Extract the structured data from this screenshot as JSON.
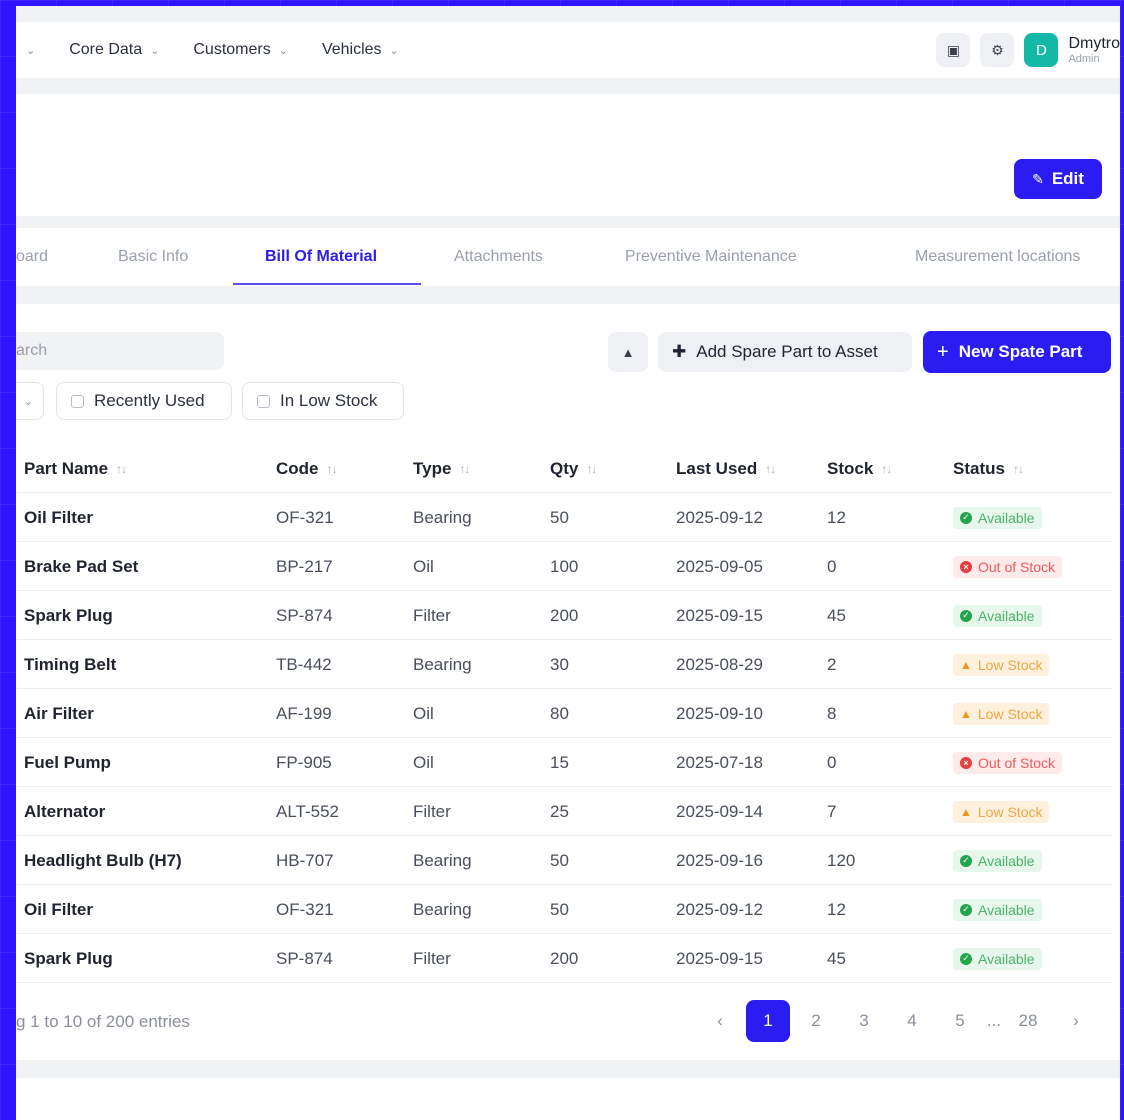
{
  "nav": {
    "items": [
      {
        "label": "Core Data"
      },
      {
        "label": "Customers"
      },
      {
        "label": "Vehicles"
      }
    ],
    "user": {
      "initial": "D",
      "name": "Dmytro",
      "role": "Admin"
    }
  },
  "header": {
    "edit_label": "Edit"
  },
  "tabs": [
    {
      "label": "oard"
    },
    {
      "label": "Basic Info"
    },
    {
      "label": "Bill Of Material"
    },
    {
      "label": "Attachments"
    },
    {
      "label": "Preventive Maintenance"
    },
    {
      "label": "Measurement locations"
    }
  ],
  "toolbar": {
    "search_placeholder": "arch",
    "add_asset_label": "Add Spare Part to Asset",
    "new_part_label": "New Spate Part",
    "filters": [
      "Recently Used",
      "In Low Stock"
    ]
  },
  "table": {
    "headers": [
      "Part Name",
      "Code",
      "Type",
      "Qty",
      "Last Used",
      "Stock",
      "Status"
    ],
    "rows": [
      {
        "name": "Oil Filter",
        "code": "OF-321",
        "type": "Bearing",
        "qty": "50",
        "last_used": "2025-09-12",
        "stock": "12",
        "status": "Available"
      },
      {
        "name": "Brake Pad Set",
        "code": "BP-217",
        "type": "Oil",
        "qty": "100",
        "last_used": "2025-09-05",
        "stock": "0",
        "status": "Out of Stock"
      },
      {
        "name": "Spark Plug",
        "code": "SP-874",
        "type": "Filter",
        "qty": "200",
        "last_used": "2025-09-15",
        "stock": "45",
        "status": "Available"
      },
      {
        "name": "Timing Belt",
        "code": "TB-442",
        "type": "Bearing",
        "qty": "30",
        "last_used": "2025-08-29",
        "stock": "2",
        "status": "Low Stock"
      },
      {
        "name": "Air Filter",
        "code": "AF-199",
        "type": "Oil",
        "qty": "80",
        "last_used": "2025-09-10",
        "stock": "8",
        "status": "Low Stock"
      },
      {
        "name": "Fuel Pump",
        "code": "FP-905",
        "type": "Oil",
        "qty": "15",
        "last_used": "2025-07-18",
        "stock": "0",
        "status": "Out of Stock"
      },
      {
        "name": "Alternator",
        "code": "ALT-552",
        "type": "Filter",
        "qty": "25",
        "last_used": "2025-09-14",
        "stock": "7",
        "status": "Low Stock"
      },
      {
        "name": "Headlight Bulb (H7)",
        "code": "HB-707",
        "type": "Bearing",
        "qty": "50",
        "last_used": "2025-09-16",
        "stock": "120",
        "status": "Available"
      },
      {
        "name": "Oil Filter",
        "code": "OF-321",
        "type": "Bearing",
        "qty": "50",
        "last_used": "2025-09-12",
        "stock": "12",
        "status": "Available"
      },
      {
        "name": "Spark Plug",
        "code": "SP-874",
        "type": "Filter",
        "qty": "200",
        "last_used": "2025-09-15",
        "stock": "45",
        "status": "Available"
      }
    ]
  },
  "footer": {
    "entries_text": "g 1 to 10 of 200 entries",
    "pages": [
      "1",
      "2",
      "3",
      "4",
      "5",
      "...",
      "28"
    ]
  },
  "colors": {
    "accent": "#2b1cf2",
    "background": "#2f15ff"
  }
}
